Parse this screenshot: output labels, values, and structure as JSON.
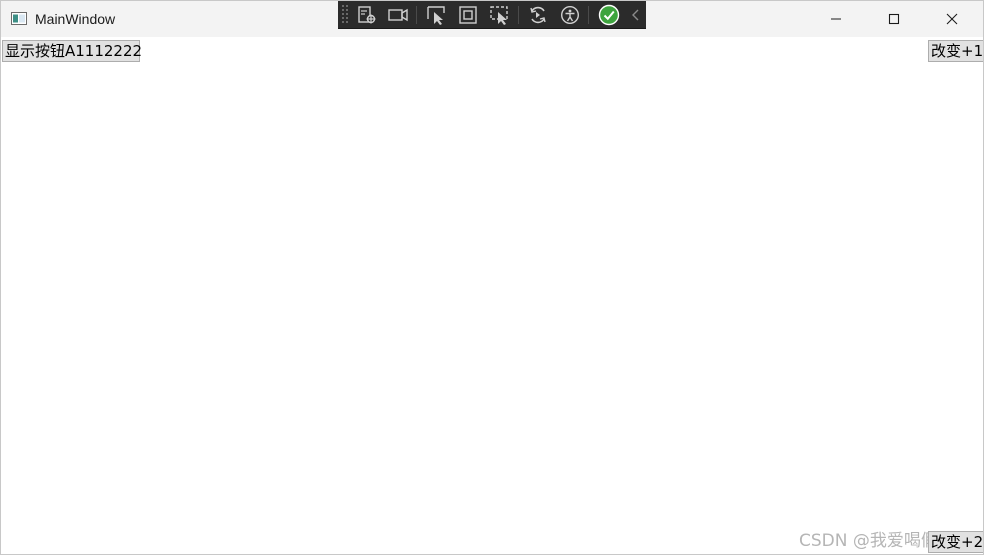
{
  "window": {
    "title": "MainWindow",
    "app_icon": "window-app-icon",
    "controls": {
      "minimize": "minimize-icon",
      "maximize": "maximize-icon",
      "close": "close-icon"
    }
  },
  "debug_toolbar": {
    "items": [
      "live-visual-tree-icon",
      "record-icon",
      "select-element-icon",
      "display-layout-adorners-icon",
      "track-focused-element-icon",
      "hot-reload-icon",
      "accessibility-icon",
      "binding-check-icon",
      "collapse-chevron-icon"
    ],
    "colors": {
      "background": "#2b2b2b",
      "icon": "#d0d0d0",
      "check": "#3ea43e"
    }
  },
  "content": {
    "show_button_label": "显示按钮A1112222",
    "change1_label": "改变+1",
    "change2_label": "改变+2"
  },
  "watermark": "CSDN @我爱喝假酒"
}
